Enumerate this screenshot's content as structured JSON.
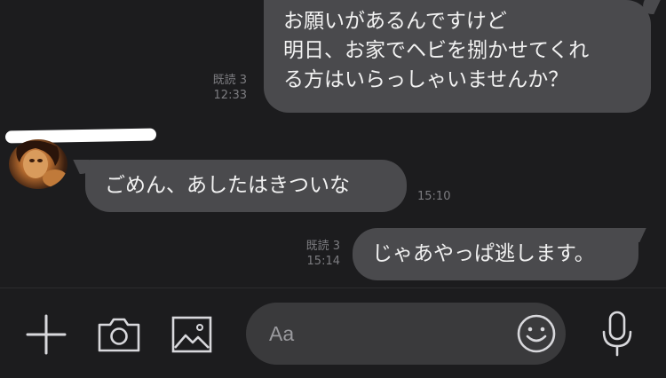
{
  "messages": [
    {
      "side": "right",
      "lines": [
        "お願いがあるんですけど",
        "明日、お家でヘビを捌かせてくれ",
        "る方はいらっしゃいませんか？"
      ],
      "read_label": "既読 3",
      "time": "12:33"
    },
    {
      "side": "left",
      "lines": [
        "ごめん、あしたはきついな"
      ],
      "time": "15:10"
    },
    {
      "side": "right",
      "lines": [
        "じゃあやっぱ逃します。"
      ],
      "read_label": "既読 3",
      "time": "15:14"
    }
  ],
  "input": {
    "placeholder": "Aa"
  },
  "icons": {
    "add": "plus-icon",
    "camera": "camera-icon",
    "image": "image-icon",
    "emoji": "emoji-icon",
    "mic": "microphone-icon"
  },
  "colors": {
    "background": "#1c1c1e",
    "bubble": "#4a4a4d",
    "text": "#f2f2f2",
    "meta": "#7c7c80",
    "input_pill": "#3a3a3c"
  }
}
